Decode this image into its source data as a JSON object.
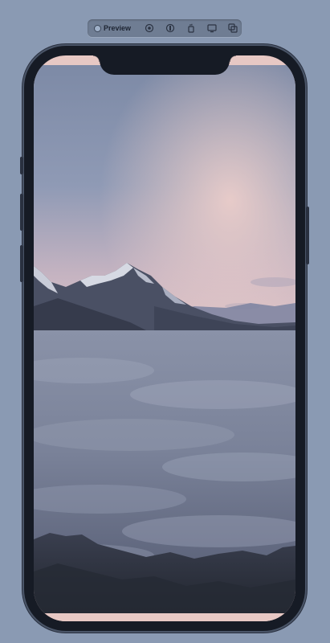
{
  "toolbar": {
    "preview_label": "Preview",
    "icons": [
      "live-preview-icon",
      "inspect-icon",
      "rotate-icon",
      "device-settings-icon",
      "duplicate-preview-icon"
    ]
  },
  "device": {
    "model": "iPhone",
    "wallpaper": "mountain-peaks-above-sea-of-clouds"
  },
  "colors": {
    "canvas_bg": "#8a9ab3",
    "toolbar_bg": "#6f7d93",
    "device_frame": "#161b25",
    "sky_top": "#7d8aa6",
    "sky_glow": "#e7c8c4"
  }
}
